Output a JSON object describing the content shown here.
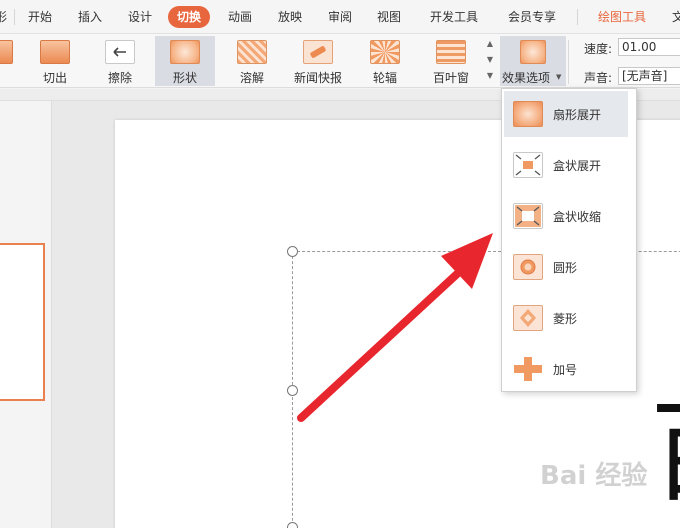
{
  "menu": {
    "partial_left": "形",
    "tabs": [
      "开始",
      "插入",
      "设计",
      "切换",
      "动画",
      "放映",
      "审阅",
      "视图",
      "开发工具",
      "会员专享"
    ],
    "active_tab": "切换",
    "contextual_tab": "绘图工具",
    "partial_right": "文"
  },
  "ribbon": {
    "effects": [
      {
        "label": "切出",
        "icon": "cut-out-icon"
      },
      {
        "label": "擦除",
        "icon": "wipe-icon"
      },
      {
        "label": "形状",
        "icon": "shape-icon"
      },
      {
        "label": "溶解",
        "icon": "dissolve-icon"
      },
      {
        "label": "新闻快报",
        "icon": "newsflash-icon"
      },
      {
        "label": "轮辐",
        "icon": "wheel-icon"
      },
      {
        "label": "百叶窗",
        "icon": "blinds-icon"
      }
    ],
    "selected_effect": "形状",
    "effect_options_label": "效果选项",
    "speed_label": "速度:",
    "speed_value": "01.00",
    "sound_label": "声音:",
    "sound_value": "[无声音]"
  },
  "dropdown": {
    "items": [
      {
        "label": "扇形展开",
        "icon": "sector-expand-icon"
      },
      {
        "label": "盒状展开",
        "icon": "box-out-icon"
      },
      {
        "label": "盒状收缩",
        "icon": "box-in-icon"
      },
      {
        "label": "圆形",
        "icon": "circle-icon"
      },
      {
        "label": "菱形",
        "icon": "diamond-icon"
      },
      {
        "label": "加号",
        "icon": "plus-icon"
      }
    ],
    "highlighted": "扇形展开"
  },
  "slide": {
    "visible_text": "百"
  },
  "watermark": "Bai 经验",
  "colors": {
    "accent": "#e8663d",
    "arrow": "#e8262d"
  }
}
